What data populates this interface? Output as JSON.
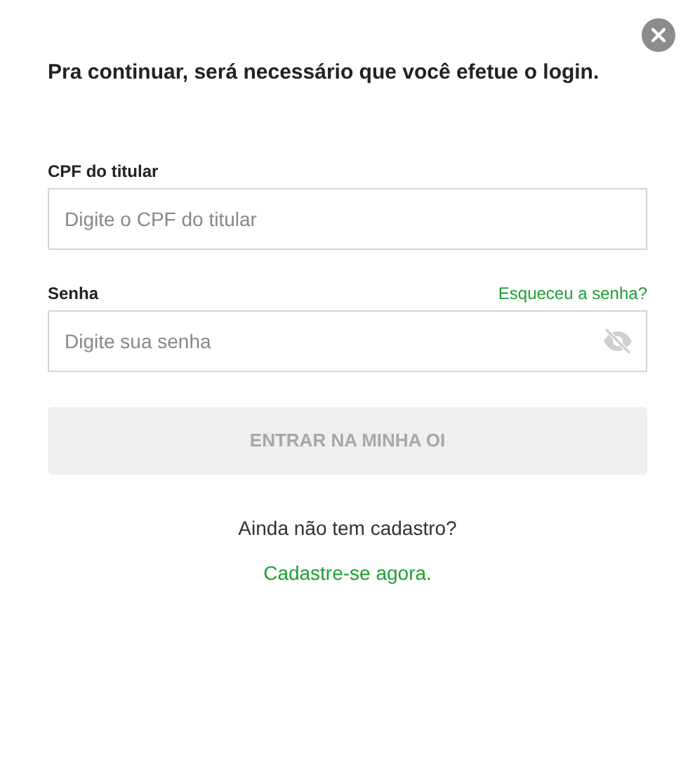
{
  "heading": "Pra continuar, será necessário que você efetue o login.",
  "fields": [
    {
      "label": "CPF do titular",
      "placeholder": "Digite o CPF do titular",
      "kind": "text"
    },
    {
      "label": "Senha",
      "placeholder": "Digite sua senha",
      "kind": "password",
      "link": "Esqueceu a senha?"
    }
  ],
  "submit": {
    "label": "ENTRAR NA MINHA OI",
    "disabled": true
  },
  "signup": {
    "prompt": "Ainda não tem cadastro?",
    "link": "Cadastre-se agora."
  }
}
